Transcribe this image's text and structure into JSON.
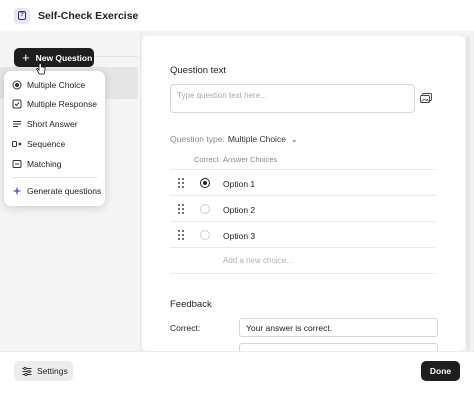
{
  "window": {
    "title": "Self-Check Exercise"
  },
  "sidebar": {
    "new_question_label": "New Question"
  },
  "dropdown": {
    "items": [
      {
        "label": "Multiple Choice",
        "icon": "radio-icon"
      },
      {
        "label": "Multiple Response",
        "icon": "checkbox-icon"
      },
      {
        "label": "Short Answer",
        "icon": "text-lines-icon"
      },
      {
        "label": "Sequence",
        "icon": "sequence-icon"
      },
      {
        "label": "Matching",
        "icon": "matching-icon"
      }
    ],
    "generate_label": "Generate questions"
  },
  "editor": {
    "question_text_heading": "Question text",
    "question_placeholder": "Type question text here...",
    "question_type_label": "Question type:",
    "question_type_value": "Multiple Choice",
    "col_correct": "Correct",
    "col_answer_choices": "Answer Choices",
    "options": [
      {
        "label": "Option 1",
        "selected": true
      },
      {
        "label": "Option 2",
        "selected": false
      },
      {
        "label": "Option 3",
        "selected": false
      }
    ],
    "add_choice_placeholder": "Add a new choice...",
    "feedback_heading": "Feedback",
    "correct_label": "Correct:",
    "correct_feedback": "Your answer is correct."
  },
  "footer": {
    "settings_label": "Settings",
    "done_label": "Done"
  },
  "colors": {
    "primary_dark": "#1e1e1e",
    "sidebar_bg": "#f5f5f5",
    "accent_purple": "#ebe4f7",
    "generate_icon": "#6b5bd6"
  }
}
